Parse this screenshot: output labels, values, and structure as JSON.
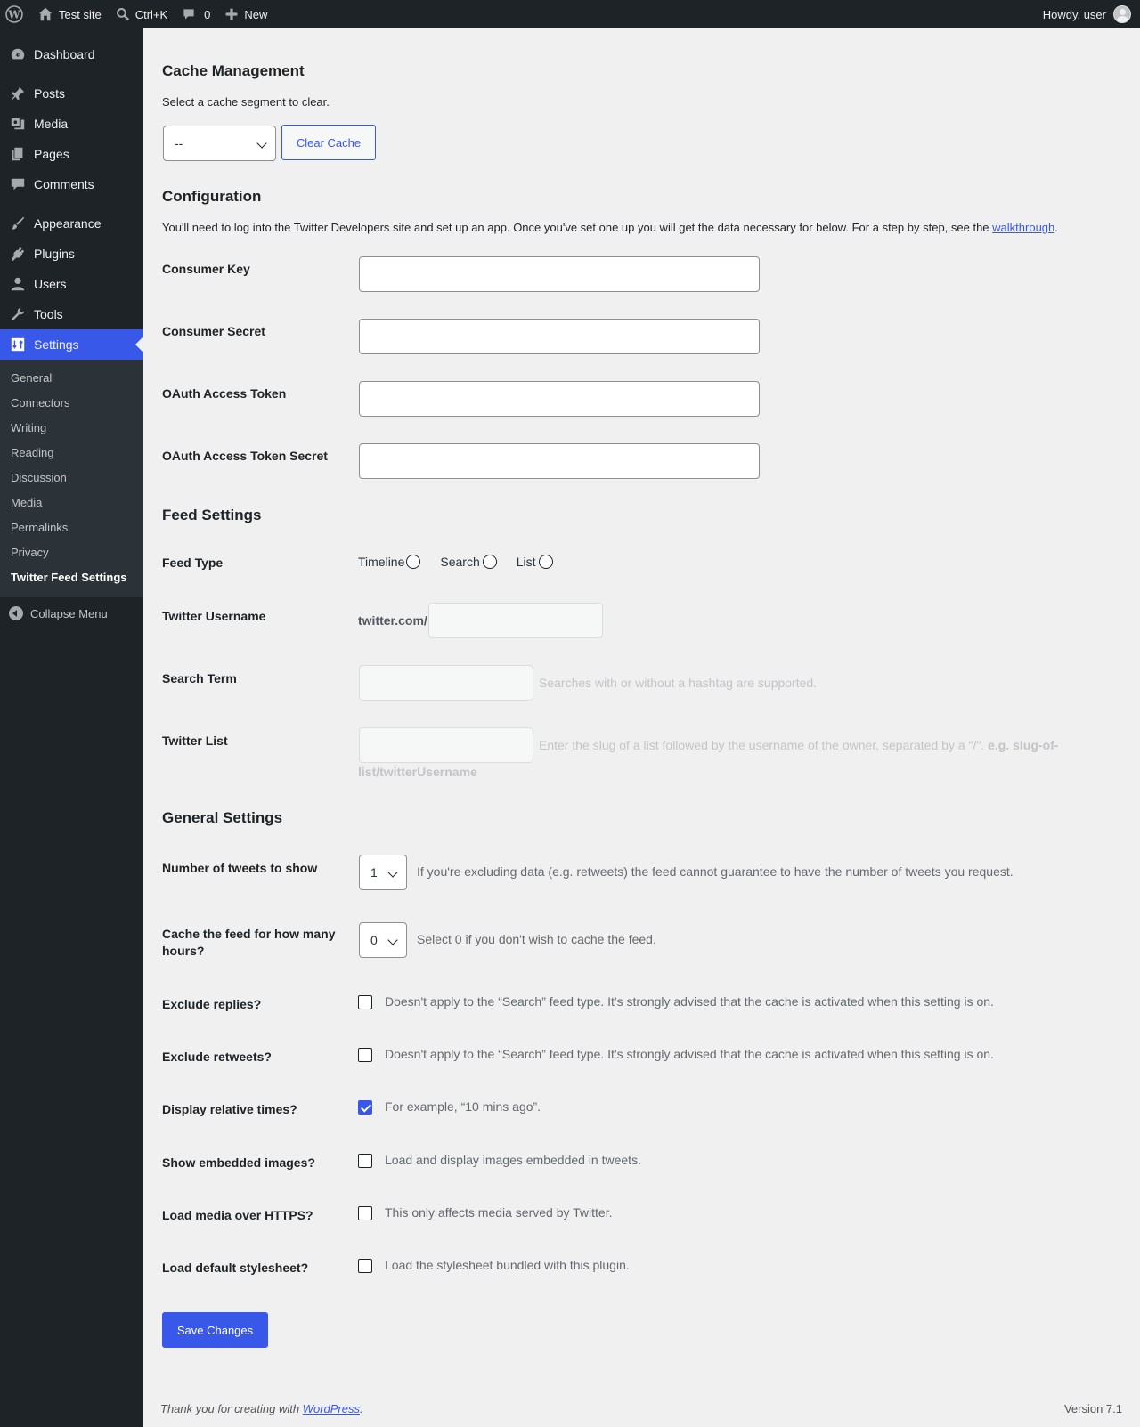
{
  "admin_bar": {
    "site_name": "Test site",
    "command_shortcut": "Ctrl+K",
    "comments_count": "0",
    "new_label": "New",
    "greeting": "Howdy, user"
  },
  "sidebar": {
    "items": [
      {
        "label": "Dashboard",
        "icon": "dashboard-icon"
      },
      {
        "label": "Posts",
        "icon": "pin-icon"
      },
      {
        "label": "Media",
        "icon": "media-icon"
      },
      {
        "label": "Pages",
        "icon": "pages-icon"
      },
      {
        "label": "Comments",
        "icon": "comment-icon"
      },
      {
        "label": "Appearance",
        "icon": "brush-icon"
      },
      {
        "label": "Plugins",
        "icon": "plug-icon"
      },
      {
        "label": "Users",
        "icon": "user-icon"
      },
      {
        "label": "Tools",
        "icon": "wrench-icon"
      },
      {
        "label": "Settings",
        "icon": "settings-icon"
      }
    ],
    "submenu": [
      "General",
      "Connectors",
      "Writing",
      "Reading",
      "Discussion",
      "Media",
      "Permalinks",
      "Privacy",
      "Twitter Feed Settings"
    ],
    "collapse_label": "Collapse Menu"
  },
  "cache": {
    "heading": "Cache Management",
    "intro": "Select a cache segment to clear.",
    "select_value": "--",
    "button": "Clear Cache"
  },
  "config": {
    "heading": "Configuration",
    "intro_before": "You'll need to log into the Twitter Developers site and set up an app. Once you've set one up you will get the data necessary for below. For a step by step, see the ",
    "intro_link": "walkthrough",
    "intro_after": ".",
    "fields": [
      "Consumer Key",
      "Consumer Secret",
      "OAuth Access Token",
      "OAuth Access Token Secret"
    ]
  },
  "feed": {
    "heading": "Feed Settings",
    "feed_type_label": "Feed Type",
    "feed_types": [
      "Timeline",
      "Search",
      "List"
    ],
    "username_label": "Twitter Username",
    "username_prefix": "twitter.com/",
    "search_label": "Search Term",
    "search_desc": "Searches with or without a hashtag are supported.",
    "list_label": "Twitter List",
    "list_desc_line1": "Enter the slug of a list followed by the username of the owner, separated by a \"/\".",
    "list_desc_example": "e.g. slug-of-",
    "list_desc_line2": "list/twitterUsername"
  },
  "general": {
    "heading": "General Settings",
    "tweets_label": "Number of tweets to show",
    "tweets_value": "1",
    "tweets_desc": "If you're excluding data (e.g. retweets) the feed cannot guarantee to have the number of tweets you request.",
    "cache_label_1": "Cache the feed for how many",
    "cache_label_2": "hours?",
    "cache_value": "0",
    "cache_desc": "Select 0 if you don't wish to cache the feed.",
    "checkboxes": [
      {
        "label": "Exclude replies?",
        "desc": "Doesn't apply to the “Search” feed type. It's strongly advised that the cache is activated when this setting is on.",
        "checked": false
      },
      {
        "label": "Exclude retweets?",
        "desc": "Doesn't apply to the “Search” feed type. It's strongly advised that the cache is activated when this setting is on.",
        "checked": false
      },
      {
        "label": "Display relative times?",
        "desc": "For example, “10 mins ago”.",
        "checked": true
      },
      {
        "label": "Show embedded images?",
        "desc": "Load and display images embedded in tweets.",
        "checked": false
      },
      {
        "label": "Load media over HTTPS?",
        "desc": "This only affects media served by Twitter.",
        "checked": false
      },
      {
        "label": "Load default stylesheet?",
        "desc": "Load the stylesheet bundled with this plugin.",
        "checked": false
      }
    ],
    "save_button": "Save Changes"
  },
  "footer": {
    "thanks_before": "Thank you for creating with ",
    "thanks_link": "WordPress",
    "thanks_after": ".",
    "version": "Version 7.1"
  },
  "colors": {
    "accent": "#3858e9",
    "adminbar": "#1d2327",
    "background": "#f0f0f1"
  }
}
